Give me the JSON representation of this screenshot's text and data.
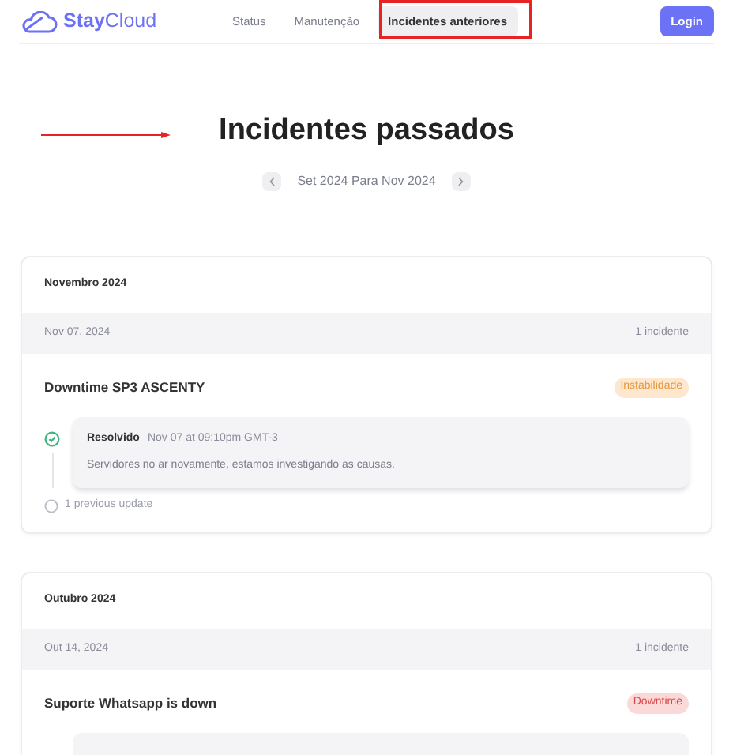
{
  "brand": {
    "first": "Stay",
    "second": "Cloud"
  },
  "nav": [
    {
      "label": "Status",
      "selected": false
    },
    {
      "label": "Manutenção",
      "selected": false
    },
    {
      "label": "Incidentes anteriores",
      "selected": true
    }
  ],
  "login": "Login",
  "title": "Incidentes passados",
  "range": "Set 2024 Para Nov 2024",
  "months": [
    {
      "month": "Novembro 2024",
      "date": "Nov 07, 2024",
      "count": "1 incidente",
      "incident": {
        "title": "Downtime SP3 ASCENTY",
        "badge": "Instabilidade",
        "kind": "instability",
        "update": {
          "kind": "full",
          "status": "Resolvido",
          "time": "Nov 07 at 09:10pm GMT-3",
          "message": "Servidores no ar novamente, estamos investigando as causas."
        },
        "previous": "1 previous update"
      }
    },
    {
      "month": "Outubro 2024",
      "date": "Out 14, 2024",
      "count": "1 incidente",
      "incident": {
        "title": "Suporte Whatsapp is down",
        "badge": "Downtime",
        "kind": "downtime",
        "update": {
          "kind": "clipped"
        }
      }
    }
  ]
}
